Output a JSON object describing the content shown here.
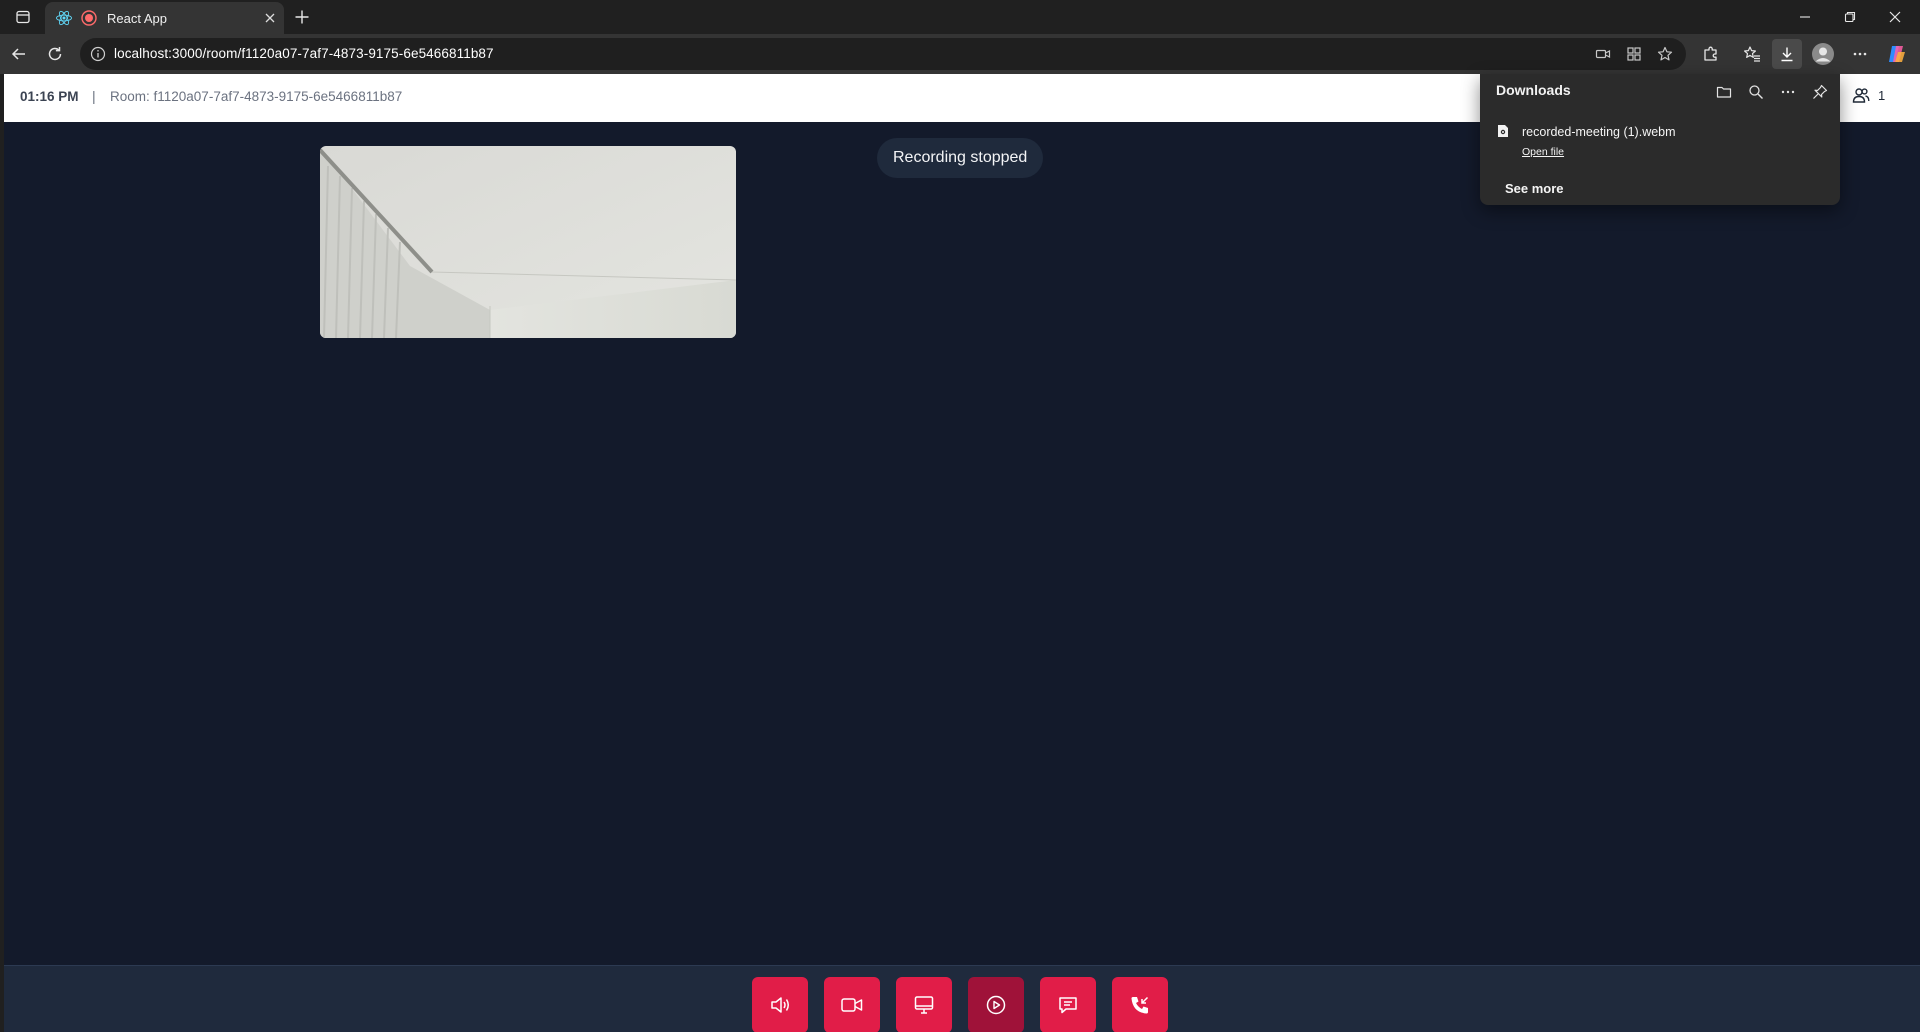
{
  "browser": {
    "tab": {
      "title": "React App"
    },
    "address": {
      "url": "localhost:3000/room/f1120a07-7af7-4873-9175-6e5466811b87"
    },
    "icons": {
      "sidebar": "sidebar-icon",
      "react": "react-logo-icon",
      "recording": "recording-indicator-icon",
      "close_tab": "close-icon",
      "new_tab": "plus-icon",
      "back": "back-arrow-icon",
      "refresh": "refresh-icon",
      "site_info": "info-icon",
      "camera_in_use": "camera-icon",
      "app_available": "apps-icon",
      "favorite": "star-icon",
      "extensions": "puzzle-icon",
      "favorites": "favorites-icon",
      "downloads": "download-icon",
      "profile": "profile-icon",
      "more": "more-icon",
      "copilot": "copilot-icon",
      "minimize": "minimize-icon",
      "restore": "restore-icon",
      "close_window": "close-icon"
    }
  },
  "app": {
    "header": {
      "time": "01:16 PM",
      "separator": "|",
      "room_label": "Room: f1120a07-7af7-4873-9175-6e5466811b87",
      "participant_count": "1"
    },
    "toast": "Recording stopped",
    "controls": [
      {
        "name": "speaker",
        "icon": "speaker-icon"
      },
      {
        "name": "camera",
        "icon": "video-icon"
      },
      {
        "name": "screen-share",
        "icon": "monitor-icon"
      },
      {
        "name": "record",
        "icon": "record-icon",
        "active": true
      },
      {
        "name": "chat",
        "icon": "chat-icon"
      },
      {
        "name": "leave-call",
        "icon": "phone-icon"
      }
    ]
  },
  "downloads_panel": {
    "title": "Downloads",
    "icons": [
      "folder-icon",
      "search-icon",
      "more-icon",
      "pin-icon"
    ],
    "items": [
      {
        "filename": "recorded-meeting (1).webm",
        "action": "Open file"
      }
    ],
    "see_more": "See more"
  },
  "colors": {
    "page_bg": "#131a2b",
    "control_red": "#e11d48",
    "control_active": "#9f1239",
    "bottom_bar": "#1f2a3d",
    "browser_chrome": "#202020"
  }
}
